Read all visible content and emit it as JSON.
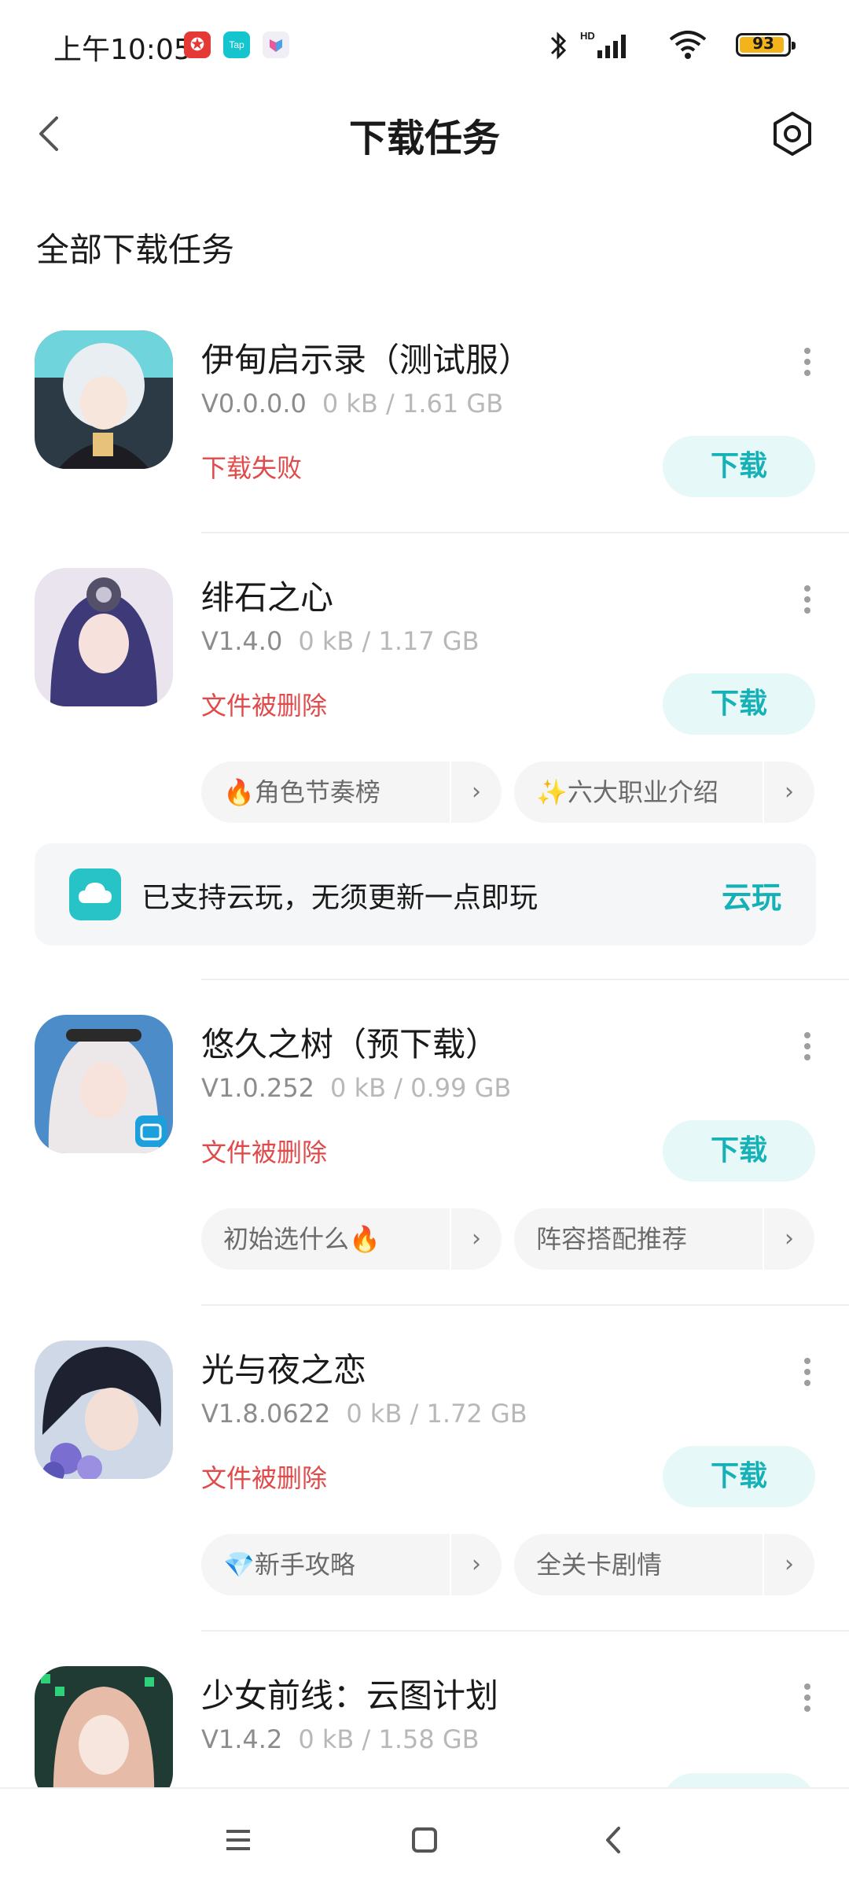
{
  "status_bar": {
    "time": "上午10:05",
    "notif_netease": "✪",
    "notif_tap": "Tap",
    "hd": "HD",
    "battery": "93",
    "battery_level": 0.93
  },
  "header": {
    "title": "下载任务"
  },
  "section_title": "全部下载任务",
  "tasks": [
    {
      "name": "伊甸启示录（测试服）",
      "version": "V0.0.0.0",
      "size": "0 kB / 1.61 GB",
      "status": "下载失败",
      "button": "下载"
    },
    {
      "name": "绯石之心",
      "version": "V1.4.0",
      "size": "0 kB / 1.17 GB",
      "status": "文件被删除",
      "button": "下载",
      "tags": [
        "🔥角色节奏榜",
        "✨六大职业介绍"
      ]
    },
    {
      "name": "悠久之树（预下载）",
      "version": "V1.0.252",
      "size": "0 kB / 0.99 GB",
      "status": "文件被删除",
      "button": "下载",
      "tags": [
        "初始选什么🔥",
        "阵容搭配推荐"
      ]
    },
    {
      "name": "光与夜之恋",
      "version": "V1.8.0622",
      "size": "0 kB / 1.72 GB",
      "status": "文件被删除",
      "button": "下载",
      "tags": [
        "💎新手攻略",
        "全关卡剧情"
      ]
    },
    {
      "name": "少女前线：云图计划",
      "version": "V1.4.2",
      "size": "0 kB / 1.58 GB"
    }
  ],
  "cloud": {
    "text": "已支持云玩，无须更新一点即玩",
    "action": "云玩"
  },
  "colors": {
    "accent": "#14b1b6",
    "error": "#e04a4a",
    "button_bg": "#e6f8f8"
  }
}
